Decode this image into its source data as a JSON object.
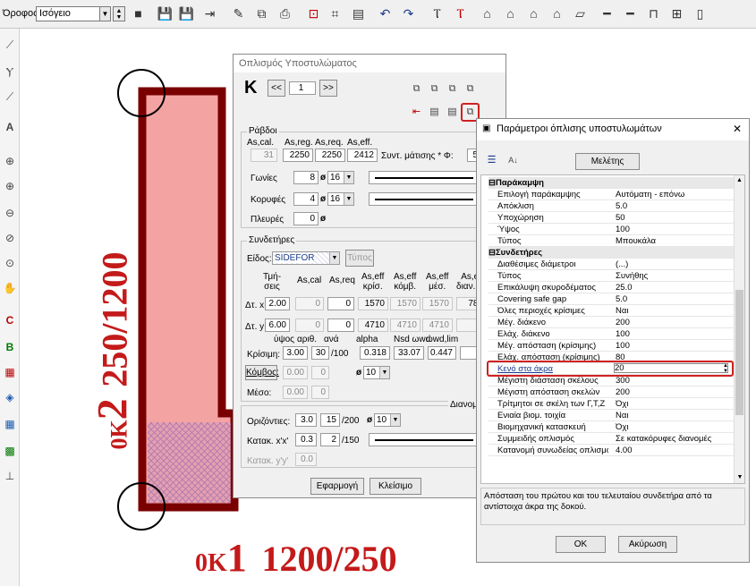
{
  "toolbar": {
    "floor_label": "Όροφος",
    "floor_value": "Ισόγειο",
    "icons": [
      "save-icon",
      "save-as-icon",
      "export-icon",
      "edit-icon",
      "view-icon",
      "print-icon",
      "select-icon",
      "grid-icon",
      "layer-icon",
      "undo-icon",
      "redo-icon",
      "column-icon",
      "column2-icon",
      "building-icon",
      "building2-icon",
      "building3-icon",
      "building4-icon",
      "slab-icon",
      "beam-icon",
      "beam2-icon",
      "frame-icon",
      "node-icon",
      "wall-icon"
    ]
  },
  "drawing": {
    "label_left_prefix": "0K",
    "label_left_num": "2",
    "label_left_dims": "250/1200",
    "label_bottom_prefix": "0K",
    "label_bottom_num": "1",
    "label_bottom_dims": "1200/250",
    "colors": {
      "wall_dark": "#7a0000",
      "wall_fill": "#f5a0a0",
      "hatch": "#b07ab0",
      "label": "#c41a1a"
    }
  },
  "column_dialog": {
    "title": "Οπλισμός Υποστυλώματος",
    "column_name": "K",
    "nav_prev": "<<",
    "nav_next": ">>",
    "index": "1",
    "bars": {
      "legend": "Ράβδοι",
      "headers": [
        "As,cal.",
        "As,reg.",
        "As,req.",
        "As,eff."
      ],
      "values": [
        "31",
        "2250",
        "2250",
        "2412"
      ],
      "factor_label": "Συντ. μάτισης * Φ:",
      "factor_value": "53.5",
      "corners_label": "Γωνίες",
      "corners_count": "8",
      "corners_dia": "16",
      "top_label": "Κορυφές",
      "top_count": "4",
      "top_dia": "16",
      "sides_label": "Πλευρές",
      "sides_count": "0",
      "phi": "ø"
    },
    "stirrups": {
      "legend": "Συνδετήρες",
      "type_label": "Είδος:",
      "type_value": "SIDEFOR",
      "type_button": "Τύπος",
      "headers": [
        "Τμή-\nσεις",
        "As,cal",
        "As,req",
        "As,eff\nκρίσ.",
        "As,eff\nκόμβ.",
        "As,eff\nμέσ.",
        "As,eff\nδιαν.(Ο)"
      ],
      "dx_label": "Δτ. x:",
      "dx_values": [
        "2.00",
        "0",
        "0",
        "1570",
        "1570",
        "1570",
        "785"
      ],
      "dy_label": "Δτ. y:",
      "dy_values": [
        "6.00",
        "0",
        "0",
        "4710",
        "4710",
        "4710",
        "0"
      ],
      "row3_headers": [
        "ύψος",
        "αριθ.",
        "ανά",
        "alpha",
        "Nsd ωwd",
        "ωwd,lim"
      ],
      "critical_label": "Κρίσιμη:",
      "critical_values": [
        "3.00",
        "30",
        "/100",
        "0.318",
        "33.07",
        "0.447",
        "0"
      ],
      "node_button": "Κόμβος:",
      "node_values": [
        "0.00",
        "0"
      ],
      "node_dia": "10",
      "mid_label": "Μέσο:",
      "mid_values": [
        "0.00",
        "0"
      ]
    },
    "distribution": {
      "legend": "Διανομές:",
      "horizontal_label": "Οριζόντιες:",
      "horizontal_values": [
        "3.0",
        "15",
        "/200"
      ],
      "horizontal_dia": "10",
      "vertx_label": "Κατακ. x'x'",
      "vertx_values": [
        "0.3",
        "2",
        "/150"
      ],
      "verty_label": "Κατακ. y'y'",
      "verty_value": "0.0"
    },
    "apply_button": "Εφαρμογή",
    "close_button": "Κλείσιμο"
  },
  "params_dialog": {
    "title": "Παράμετροι όπλισης υποστυλωμάτων",
    "close_x": "✕",
    "sort_a": "Α↓",
    "studies_button": "Μελέτης",
    "categories": [
      {
        "name": "Παράκαμψη",
        "rows": [
          {
            "name": "Επιλογή παράκαμψης",
            "value": "Αυτόματη - επόνω"
          },
          {
            "name": "Απόκλιση",
            "value": "5.0"
          },
          {
            "name": "Υποχώρηση",
            "value": "50"
          },
          {
            "name": "Ύψος",
            "value": "100"
          },
          {
            "name": "Τύπος",
            "value": "Μπουκάλα"
          }
        ]
      },
      {
        "name": "Συνδετήρες",
        "rows": [
          {
            "name": "Διαθέσιμες διάμετροι",
            "value": "(...)"
          },
          {
            "name": "Τύπος",
            "value": "Συνήθης"
          },
          {
            "name": "Επικάλυψη σκυροδέματος",
            "value": "25.0"
          },
          {
            "name": "Covering safe gap",
            "value": "5.0"
          },
          {
            "name": "Όλες περιοχές κρίσιμες",
            "value": "Ναι"
          },
          {
            "name": "Μέγ. διάκενο",
            "value": "200"
          },
          {
            "name": "Ελάχ. διάκενο",
            "value": "100"
          },
          {
            "name": "Μέγ. απόσταση (κρίσιμης)",
            "value": "100"
          },
          {
            "name": "Ελάχ. απόσταση (κρίσιμης)",
            "value": "80"
          },
          {
            "name": "Κενό στα άκρα",
            "value": "20"
          },
          {
            "name": "Μέγιστη διάσταση σκέλους",
            "value": "300"
          },
          {
            "name": "Μέγιστη απόσταση σκελών",
            "value": "200"
          },
          {
            "name": "Τρίτμητοι σε σκέλη των Γ,Τ,Ζ",
            "value": "Όχι"
          },
          {
            "name": "Ενιαία βιομ. τοιχία",
            "value": "Ναι"
          },
          {
            "name": "Βιομηχανική κατασκευή",
            "value": "Όχι"
          },
          {
            "name": "Συμμειδής οπλισμός",
            "value": "Σε κατακόρυφες διανομές"
          },
          {
            "name": "Κατανομή συνωδείας οπλισμού",
            "value": "4.00"
          }
        ]
      }
    ],
    "description": "Απόσταση του πρώτου και του τελευταίου συνδετήρα από τα αντίστοιχα άκρα της δοκού.",
    "ok_button": "OK",
    "cancel_button": "Ακύρωση"
  }
}
